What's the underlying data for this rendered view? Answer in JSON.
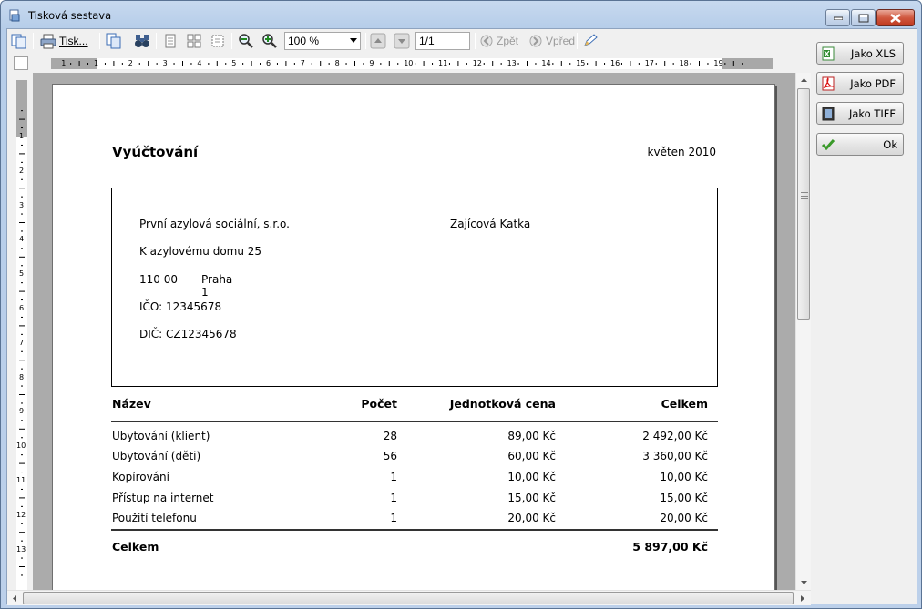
{
  "window": {
    "title": "Tisková sestava"
  },
  "toolbar": {
    "print_label": "Tisk...",
    "zoom_value": "100 %",
    "page_value": "1/1",
    "back_label": "Zpět",
    "forward_label": "Vpřed"
  },
  "ruler": {
    "h_labels": [
      "1",
      "1",
      "2",
      "3",
      "4",
      "5",
      "6",
      "7",
      "8",
      "9",
      "10",
      "11",
      "12",
      "13",
      "14",
      "15",
      "16",
      "17",
      "18",
      "19"
    ],
    "v_labels": [
      "1",
      "2",
      "3",
      "4",
      "5",
      "6",
      "7",
      "8",
      "9",
      "10",
      "11",
      "12",
      "13"
    ]
  },
  "side_buttons": {
    "xls": "Jako XLS",
    "pdf": "Jako PDF",
    "tiff": "Jako TIFF",
    "ok": "Ok"
  },
  "document": {
    "title": "Vyúčtování",
    "date": "květen 2010",
    "sender": {
      "name": "První azylová sociální, s.r.o.",
      "street": "K azylovému domu 25",
      "zip": "110 00",
      "city": "Praha 1",
      "ico": "IČO: 12345678",
      "dic": "DIČ: CZ12345678"
    },
    "recipient": "Zajícová Katka",
    "table": {
      "headers": [
        "Název",
        "Počet",
        "Jednotková cena",
        "Celkem"
      ],
      "rows": [
        {
          "name": "Ubytování (klient)",
          "count": "28",
          "unit": "89,00 Kč",
          "total": "2 492,00 Kč"
        },
        {
          "name": "Ubytování (děti)",
          "count": "56",
          "unit": "60,00 Kč",
          "total": "3 360,00 Kč"
        },
        {
          "name": "Kopírování",
          "count": "1",
          "unit": "10,00 Kč",
          "total": "10,00 Kč"
        },
        {
          "name": "Přístup na internet",
          "count": "1",
          "unit": "15,00 Kč",
          "total": "15,00 Kč"
        },
        {
          "name": "Použití telefonu",
          "count": "1",
          "unit": "20,00 Kč",
          "total": "20,00 Kč"
        }
      ],
      "total_label": "Celkem",
      "total_value": "5 897,00 Kč"
    }
  },
  "icons": {
    "app": "report-preview-icon",
    "copy": "copy-icon",
    "print": "printer-icon",
    "find": "binoculars-icon",
    "zoom_out": "zoom-out-icon",
    "zoom_in": "zoom-in-icon",
    "edit": "pencil-icon"
  }
}
